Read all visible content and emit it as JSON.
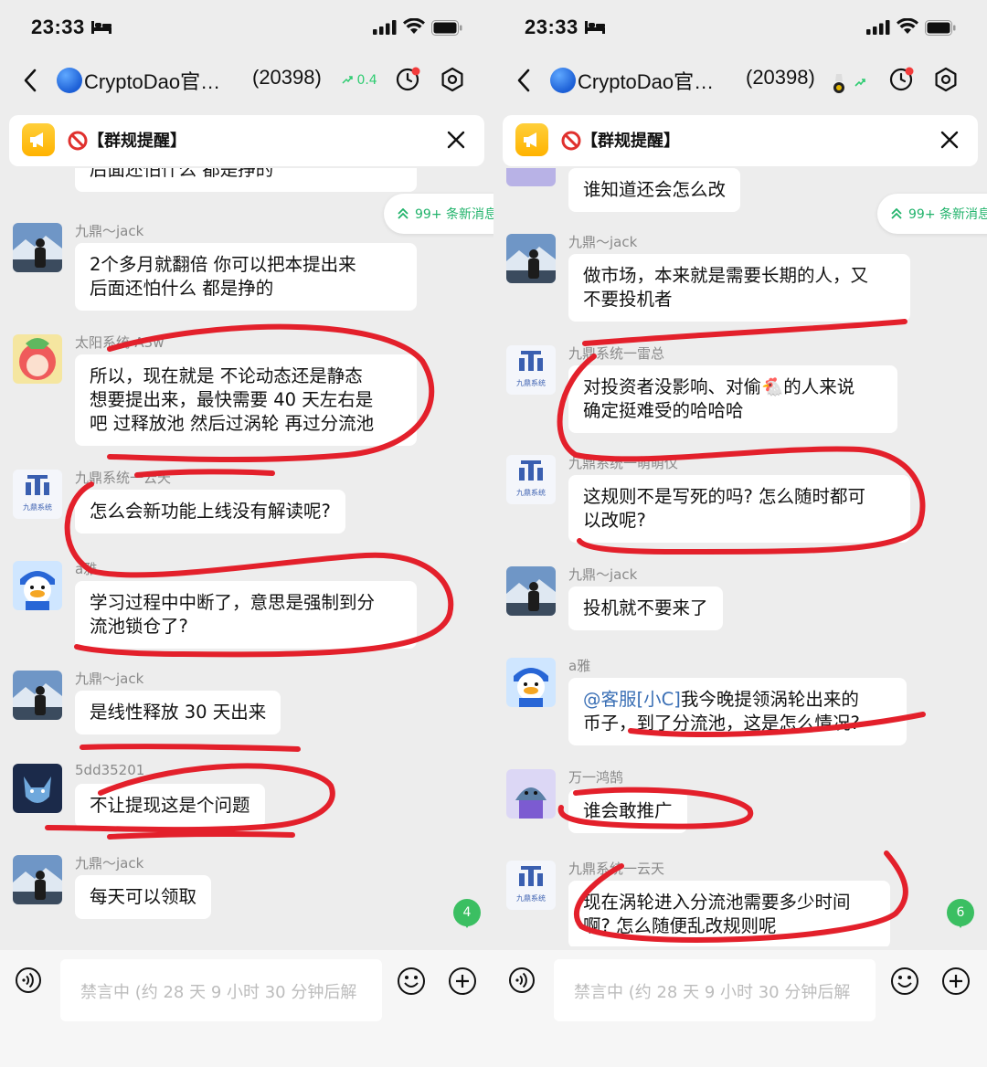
{
  "status": {
    "time": "23:33"
  },
  "chat": {
    "title": "CryptoDao官…",
    "count": "(20398)",
    "trend_left": "0.4"
  },
  "notice": {
    "text": "【群规提醒】"
  },
  "new_messages": "99+ 条新消息",
  "input": {
    "placeholder": "禁言中 (约 28 天 9 小时 30 分钟后解"
  },
  "left": {
    "unread": "4",
    "partial_top": "后面还怕什么  都是挣的",
    "messages": [
      {
        "sender": "九鼎～jack",
        "text": "2个多月就翻倍  你可以把本提出来\n后面还怕什么  都是挣的",
        "avatar": "mountain"
      },
      {
        "sender": "太阳系统-A3w",
        "text": "所以，现在就是 不论动态还是静态\n想要提出来，最快需要 40 天左右是\n吧 过释放池 然后过涡轮 再过分流池",
        "avatar": "redhair"
      },
      {
        "sender": "九鼎系统一云天",
        "text": "怎么会新功能上线没有解读呢?",
        "avatar": "logo"
      },
      {
        "sender": "a雅",
        "text": "学习过程中中断了，意思是强制到分\n流池锁仓了?",
        "avatar": "duck"
      },
      {
        "sender": "九鼎～jack",
        "text": "是线性释放 30 天出来",
        "avatar": "mountain"
      },
      {
        "sender": "5dd35201",
        "text": "不让提现这是个问题",
        "avatar": "wolf"
      },
      {
        "sender": "九鼎～jack",
        "text": "每天可以领取",
        "avatar": "mountain"
      }
    ]
  },
  "right": {
    "unread": "6",
    "partial_top": "谁知道还会怎么改",
    "messages": [
      {
        "sender": "九鼎～jack",
        "text": "做市场，本来就是需要长期的人，又\n不要投机者",
        "avatar": "mountain"
      },
      {
        "sender": "九鼎系统一雷总",
        "text": "对投资者没影响、对偷🐔的人来说\n确定挺难受的哈哈哈",
        "avatar": "logo"
      },
      {
        "sender": "九鼎系统一萌萌仪",
        "text": "这规则不是写死的吗? 怎么随时都可\n以改呢?",
        "avatar": "logo"
      },
      {
        "sender": "九鼎～jack",
        "text": "投机就不要来了",
        "avatar": "mountain"
      },
      {
        "sender": "a雅",
        "mention": "@客服[小C]",
        "text": "我今晚提领涡轮出来的\n币子，到了分流池，这是怎么情况?",
        "avatar": "duck"
      },
      {
        "sender": "万一鸿鹄",
        "text": "谁会敢推广",
        "avatar": "shark"
      },
      {
        "sender": "九鼎系统一云天",
        "text": "现在涡轮进入分流池需要多少时间\n啊? 怎么随便乱改规则呢",
        "avatar": "logo"
      }
    ]
  },
  "logo_text": "九鼎系统",
  "colors": {
    "accent_green": "#21b36b",
    "annotation_red": "#e3202b",
    "badge_green": "#3bbf62"
  }
}
